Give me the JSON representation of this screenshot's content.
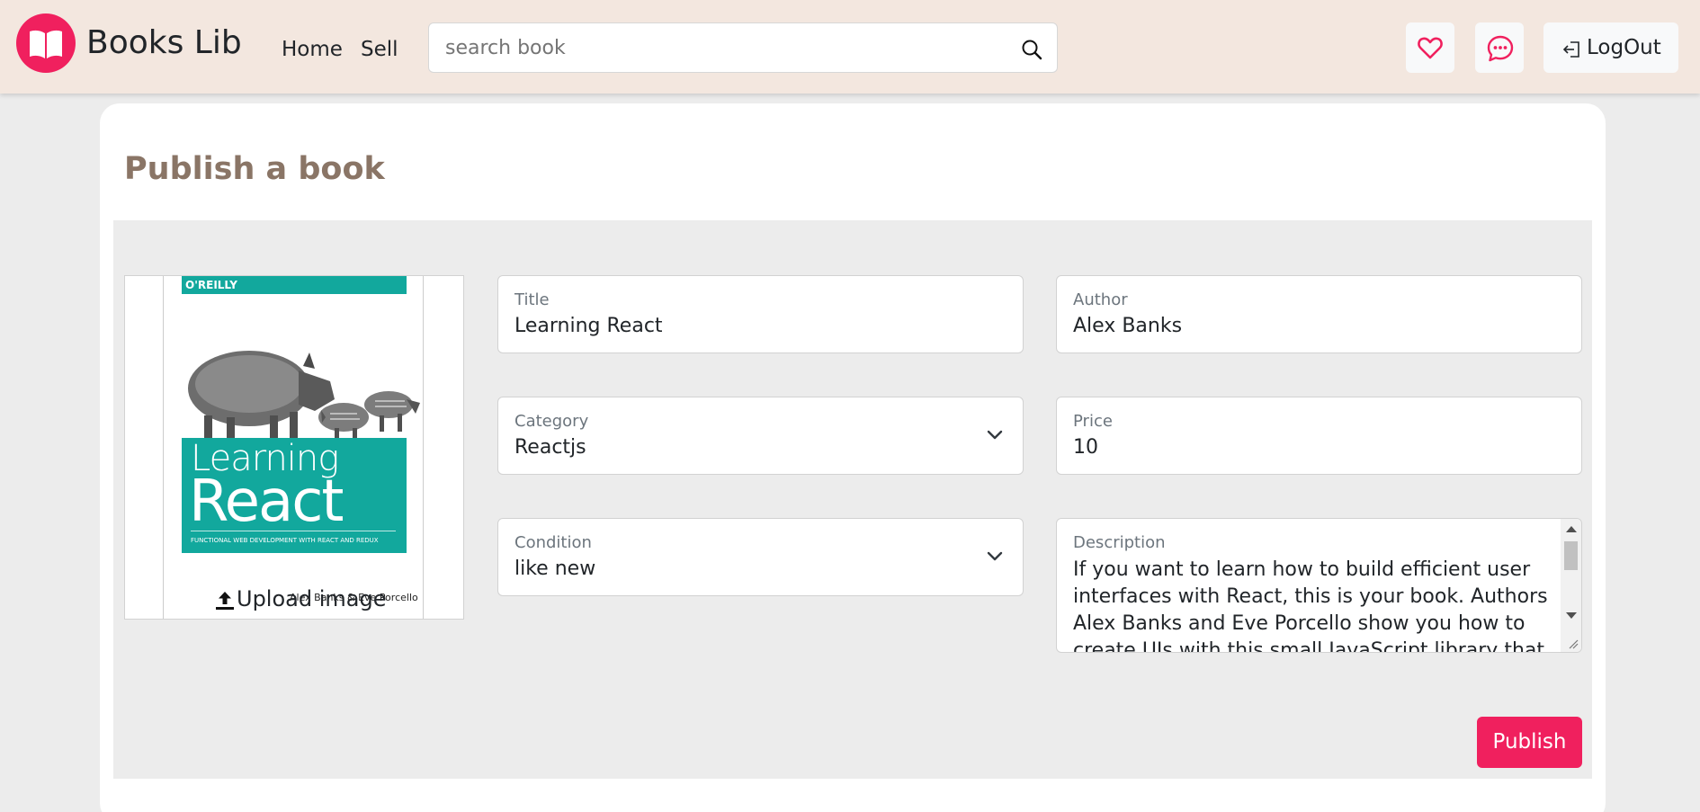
{
  "header": {
    "brand": "Books Lib",
    "nav": {
      "home": "Home",
      "sell": "Sell"
    },
    "search": {
      "placeholder": "search book",
      "value": ""
    },
    "logout_label": "LogOut"
  },
  "page": {
    "title": "Publish a book"
  },
  "cover": {
    "publisher": "O'REILLY",
    "title_line1": "Learning",
    "title_line2": "React",
    "subtitle": "FUNCTIONAL WEB DEVELOPMENT WITH REACT AND REDUX",
    "authors": "Alex Banks & Eve Porcello"
  },
  "upload_label": "Upload image",
  "form": {
    "title": {
      "label": "Title",
      "value": "Learning React"
    },
    "author": {
      "label": "Author",
      "value": "Alex Banks"
    },
    "category": {
      "label": "Category",
      "value": "Reactjs"
    },
    "price": {
      "label": "Price",
      "value": "10"
    },
    "condition": {
      "label": "Condition",
      "value": "like new"
    },
    "description": {
      "label": "Description",
      "value": "If you want to learn how to build efficient user interfaces with React, this is your book. Authors Alex Banks and Eve Porcello show you how to create UIs with this small JavaScript library that"
    }
  },
  "publish_label": "Publish",
  "colors": {
    "accent": "#f0205e",
    "header_bg": "#f3e7df",
    "title_color": "#8a7566",
    "cover_teal": "#12a89d"
  },
  "icons": {
    "logo": "open-book-icon",
    "search": "search-icon",
    "favorites": "heart-icon",
    "messages": "chat-bubble-icon",
    "logout": "logout-icon",
    "upload": "upload-icon",
    "select": "chevron-down-icon"
  }
}
